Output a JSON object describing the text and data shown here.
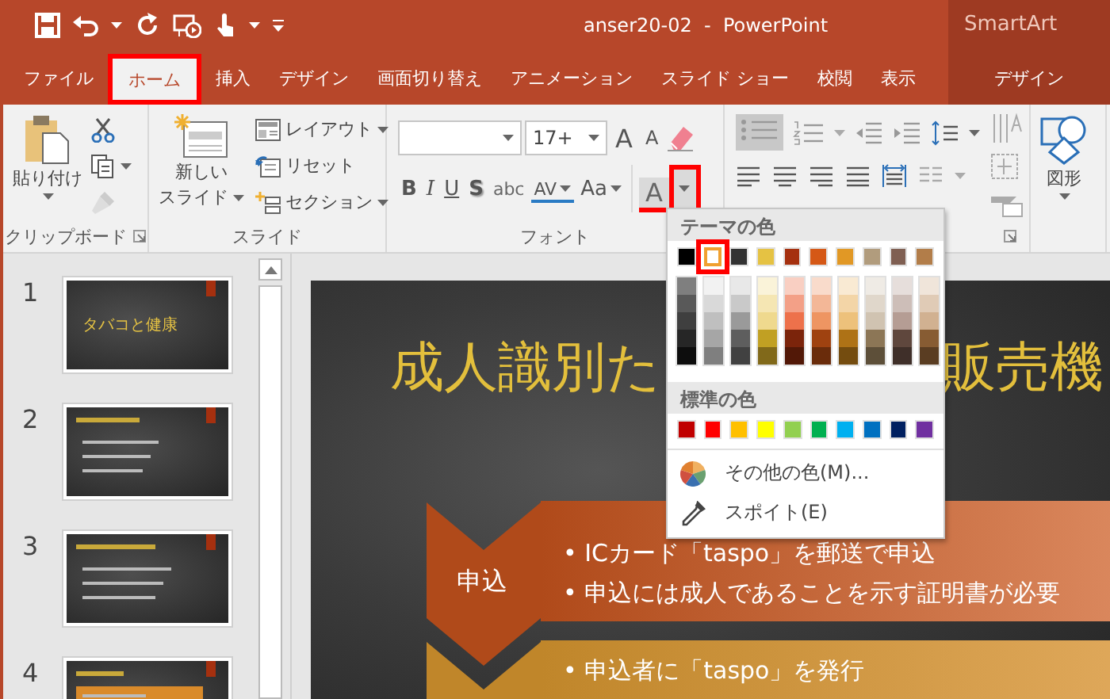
{
  "window": {
    "title": "anser20-02  -  PowerPoint",
    "context_header": "SmartArt"
  },
  "tabs": [
    {
      "label": "ファイル",
      "selected": false,
      "contextual": false,
      "highlighted": false
    },
    {
      "label": "ホーム",
      "selected": true,
      "contextual": false,
      "highlighted": true
    },
    {
      "label": "挿入",
      "selected": false,
      "contextual": false,
      "highlighted": false
    },
    {
      "label": "デザイン",
      "selected": false,
      "contextual": false,
      "highlighted": false
    },
    {
      "label": "画面切り替え",
      "selected": false,
      "contextual": false,
      "highlighted": false
    },
    {
      "label": "アニメーション",
      "selected": false,
      "contextual": false,
      "highlighted": false
    },
    {
      "label": "スライド ショー",
      "selected": false,
      "contextual": false,
      "highlighted": false
    },
    {
      "label": "校閲",
      "selected": false,
      "contextual": false,
      "highlighted": false
    },
    {
      "label": "表示",
      "selected": false,
      "contextual": false,
      "highlighted": false
    },
    {
      "label": "デザイン",
      "selected": false,
      "contextual": true,
      "highlighted": false
    }
  ],
  "ribbon": {
    "clipboard": {
      "paste": "貼り付け",
      "label": "クリップボード"
    },
    "slides": {
      "new_slide": [
        "新しい",
        "スライド"
      ],
      "layout": "レイアウト",
      "reset": "リセット",
      "section": "セクション",
      "label": "スライド"
    },
    "font": {
      "font_size": "17+",
      "grow": "A",
      "shrink": "A",
      "format_buttons": [
        {
          "label": "B",
          "kind": "bold"
        },
        {
          "label": "I",
          "kind": "italic"
        },
        {
          "label": "U",
          "kind": "underline"
        },
        {
          "label": "S",
          "kind": "shadow"
        },
        {
          "label": "abc",
          "kind": "strike"
        },
        {
          "label": "AV",
          "kind": "spacing"
        },
        {
          "label": "Aa",
          "kind": "case"
        }
      ],
      "font_color": {
        "label": "A",
        "highlighted": true
      },
      "label": "フォント"
    },
    "paragraph": {
      "bullets_active": true
    },
    "drawing": {
      "shapes": "図形"
    }
  },
  "color_menu": {
    "theme_heading": "テーマの色",
    "theme": [
      {
        "color": "#000000",
        "selected": false,
        "highlighted": false,
        "shades": [
          {
            "color": "#7f7f7f"
          },
          {
            "color": "#595959"
          },
          {
            "color": "#3f3f3f"
          },
          {
            "color": "#262626"
          },
          {
            "color": "#0d0d0d"
          }
        ]
      },
      {
        "color": "#ffffff",
        "selected": true,
        "highlighted": true,
        "shades": [
          {
            "color": "#f2f2f2"
          },
          {
            "color": "#d9d9d9"
          },
          {
            "color": "#bfbfbf"
          },
          {
            "color": "#a6a6a6"
          },
          {
            "color": "#7f7f7f"
          }
        ]
      },
      {
        "color": "#323232",
        "selected": false,
        "highlighted": false,
        "shades": [
          {
            "color": "#e8e8e8"
          },
          {
            "color": "#c9c9c9"
          },
          {
            "color": "#9a9a9a"
          },
          {
            "color": "#5e5e5e"
          },
          {
            "color": "#414141"
          }
        ]
      },
      {
        "color": "#e5c243",
        "selected": false,
        "highlighted": false,
        "shades": [
          {
            "color": "#faf3d9"
          },
          {
            "color": "#f5e6b3"
          },
          {
            "color": "#efd98e"
          },
          {
            "color": "#c1a023"
          },
          {
            "color": "#81691a"
          }
        ]
      },
      {
        "color": "#a5300f",
        "selected": false,
        "highlighted": false,
        "shades": [
          {
            "color": "#f9cfc2"
          },
          {
            "color": "#f3a087"
          },
          {
            "color": "#ed714b"
          },
          {
            "color": "#7b240b"
          },
          {
            "color": "#521807"
          }
        ]
      },
      {
        "color": "#d55816",
        "selected": false,
        "highlighted": false,
        "shades": [
          {
            "color": "#f9dbcb"
          },
          {
            "color": "#f3b797"
          },
          {
            "color": "#ee9562"
          },
          {
            "color": "#9f4210"
          },
          {
            "color": "#6a2c0b"
          }
        ]
      },
      {
        "color": "#e19825",
        "selected": false,
        "highlighted": false,
        "shades": [
          {
            "color": "#f9ead3"
          },
          {
            "color": "#f3d5a7"
          },
          {
            "color": "#edc17b"
          },
          {
            "color": "#ae7216"
          },
          {
            "color": "#744c0f"
          }
        ]
      },
      {
        "color": "#b19c7d",
        "selected": false,
        "highlighted": false,
        "shades": [
          {
            "color": "#efebe5"
          },
          {
            "color": "#e0d7cb"
          },
          {
            "color": "#d0c3b1"
          },
          {
            "color": "#8c7656"
          },
          {
            "color": "#5d4f39"
          }
        ]
      },
      {
        "color": "#7f5f52",
        "selected": false,
        "highlighted": false,
        "shades": [
          {
            "color": "#e6dedb"
          },
          {
            "color": "#cdbeb8"
          },
          {
            "color": "#b59d94"
          },
          {
            "color": "#5f473d"
          },
          {
            "color": "#3f2f29"
          }
        ]
      },
      {
        "color": "#b27d49",
        "selected": false,
        "highlighted": false,
        "shades": [
          {
            "color": "#f0e5da"
          },
          {
            "color": "#e0cbb6"
          },
          {
            "color": "#d1b191"
          },
          {
            "color": "#875c33"
          },
          {
            "color": "#5a3d22"
          }
        ]
      }
    ],
    "standard_heading": "標準の色",
    "standard": [
      {
        "color": "#c00000"
      },
      {
        "color": "#ff0000"
      },
      {
        "color": "#ffc000"
      },
      {
        "color": "#ffff00"
      },
      {
        "color": "#92d050"
      },
      {
        "color": "#00b050"
      },
      {
        "color": "#00b0f0"
      },
      {
        "color": "#0070c0"
      },
      {
        "color": "#002060"
      },
      {
        "color": "#7030a0"
      }
    ],
    "items": [
      {
        "label": "その他の色(M)...",
        "kind": "more"
      },
      {
        "label": "スポイト(E)",
        "kind": "eyedropper"
      }
    ]
  },
  "thumbnails": [
    {
      "number": "1",
      "title": "タバコと健康"
    },
    {
      "number": "2"
    },
    {
      "number": "3"
    },
    {
      "number": "4"
    }
  ],
  "slide": {
    "title_parts": [
      "成人識別た",
      "販売機"
    ],
    "steps": [
      {
        "label": "申込",
        "color": "#b04a1a",
        "bullets": [
          "• ICカード「taspo」を郵送で申込",
          "• 申込には成人であることを示す証明書が必要"
        ]
      },
      {
        "color": "#c0862a",
        "bullets": [
          "• 申込者に「taspo」を発行"
        ]
      }
    ]
  }
}
